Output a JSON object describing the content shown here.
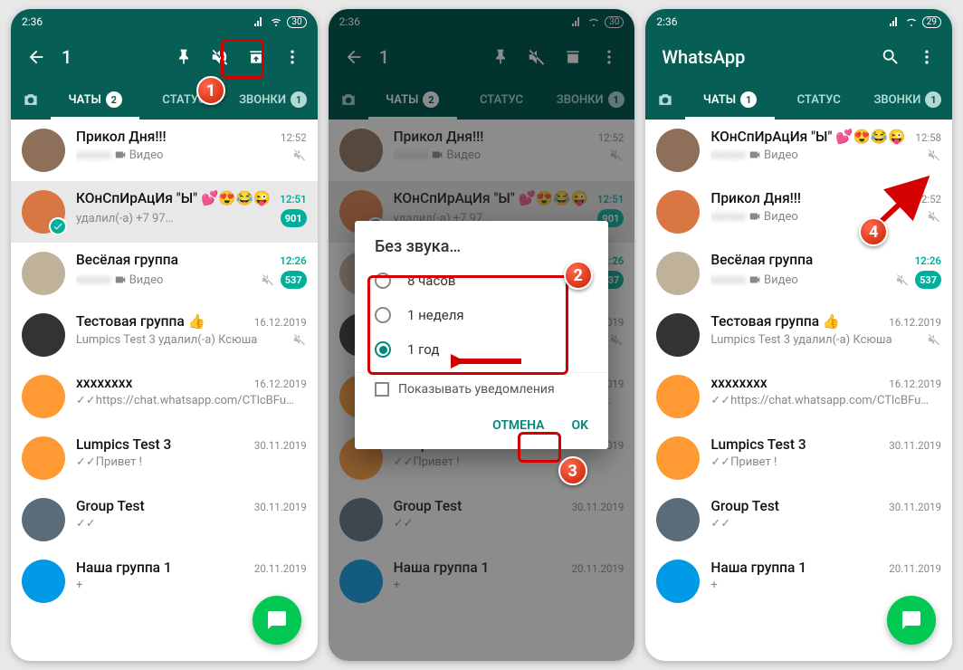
{
  "status": {
    "time": "2:36",
    "battery1": "30",
    "battery3": "29"
  },
  "screen1": {
    "title": "1",
    "tabs": {
      "chats": "ЧАТЫ",
      "status": "СТАТУС",
      "calls": "ЗВОНКИ",
      "chats_badge": "2",
      "calls_badge": "1"
    },
    "chats": [
      {
        "name": "Прикол Дня!!!",
        "time": "12:52",
        "msg": "Видео",
        "muted": true,
        "sel": false
      },
      {
        "name": "КОнСпИрАцИя \"Ы\" 💕😍😂😜",
        "time": "12:51",
        "msg": "удалил(-а) +7 97…",
        "badge": "901",
        "sel": true,
        "checked": true
      },
      {
        "name": "Весёлая группа",
        "time": "12:26",
        "msg": "Видео",
        "badge": "537",
        "muted": true
      },
      {
        "name": "Тестовая группа 👍",
        "time": "16.12.2019",
        "msg": "Lumpics Test 3 удалил(-а) Ксюша",
        "muted": true
      },
      {
        "name": "",
        "time": "16.12.2019",
        "msg": "✓✓https://chat.whatsapp.com/CTlcBFu…"
      },
      {
        "name": "Lumpics Test 3",
        "time": "30.11.2019",
        "msg": "✓✓Привет !"
      },
      {
        "name": "Group Test",
        "time": "30.11.2019",
        "msg": "✓✓"
      },
      {
        "name": "Наша группа 1",
        "time": "20.11.2019",
        "msg": "+"
      }
    ]
  },
  "screen2": {
    "title": "1",
    "dialog": {
      "title": "Без звука…",
      "opt1": "8 часов",
      "opt2": "1 неделя",
      "opt3": "1 год",
      "chk": "Показывать уведомления",
      "cancel": "ОТМЕНА",
      "ok": "OK"
    }
  },
  "screen3": {
    "title": "WhatsApp",
    "tabs": {
      "chats": "ЧАТЫ",
      "status": "СТАТУС",
      "calls": "ЗВОНКИ",
      "chats_badge": "1",
      "calls_badge": "1"
    },
    "chats": [
      {
        "name": "КОнСпИрАцИя \"Ы\" 💕😍😂😜",
        "time": "12:58",
        "msg": "Видео",
        "muted": true
      },
      {
        "name": "Прикол Дня!!!",
        "time": "12:52",
        "msg": "Видео",
        "muted": true
      },
      {
        "name": "Весёлая группа",
        "time": "12:26",
        "msg": "Видео",
        "badge": "537",
        "muted": true
      },
      {
        "name": "Тестовая группа 👍",
        "time": "16.12.2019",
        "msg": "Lumpics Test 3 удалил(-а) Ксюша",
        "muted": true
      },
      {
        "name": "",
        "time": "16.12.2019",
        "msg": "✓✓https://chat.whatsapp.com/CTlcBFu…"
      },
      {
        "name": "Lumpics Test 3",
        "time": "30.11.2019",
        "msg": "✓✓Привет !"
      },
      {
        "name": "Group Test",
        "time": "30.11.2019",
        "msg": "✓✓"
      },
      {
        "name": "Наша группа 1",
        "time": "20.11.2019",
        "msg": "+"
      }
    ]
  }
}
